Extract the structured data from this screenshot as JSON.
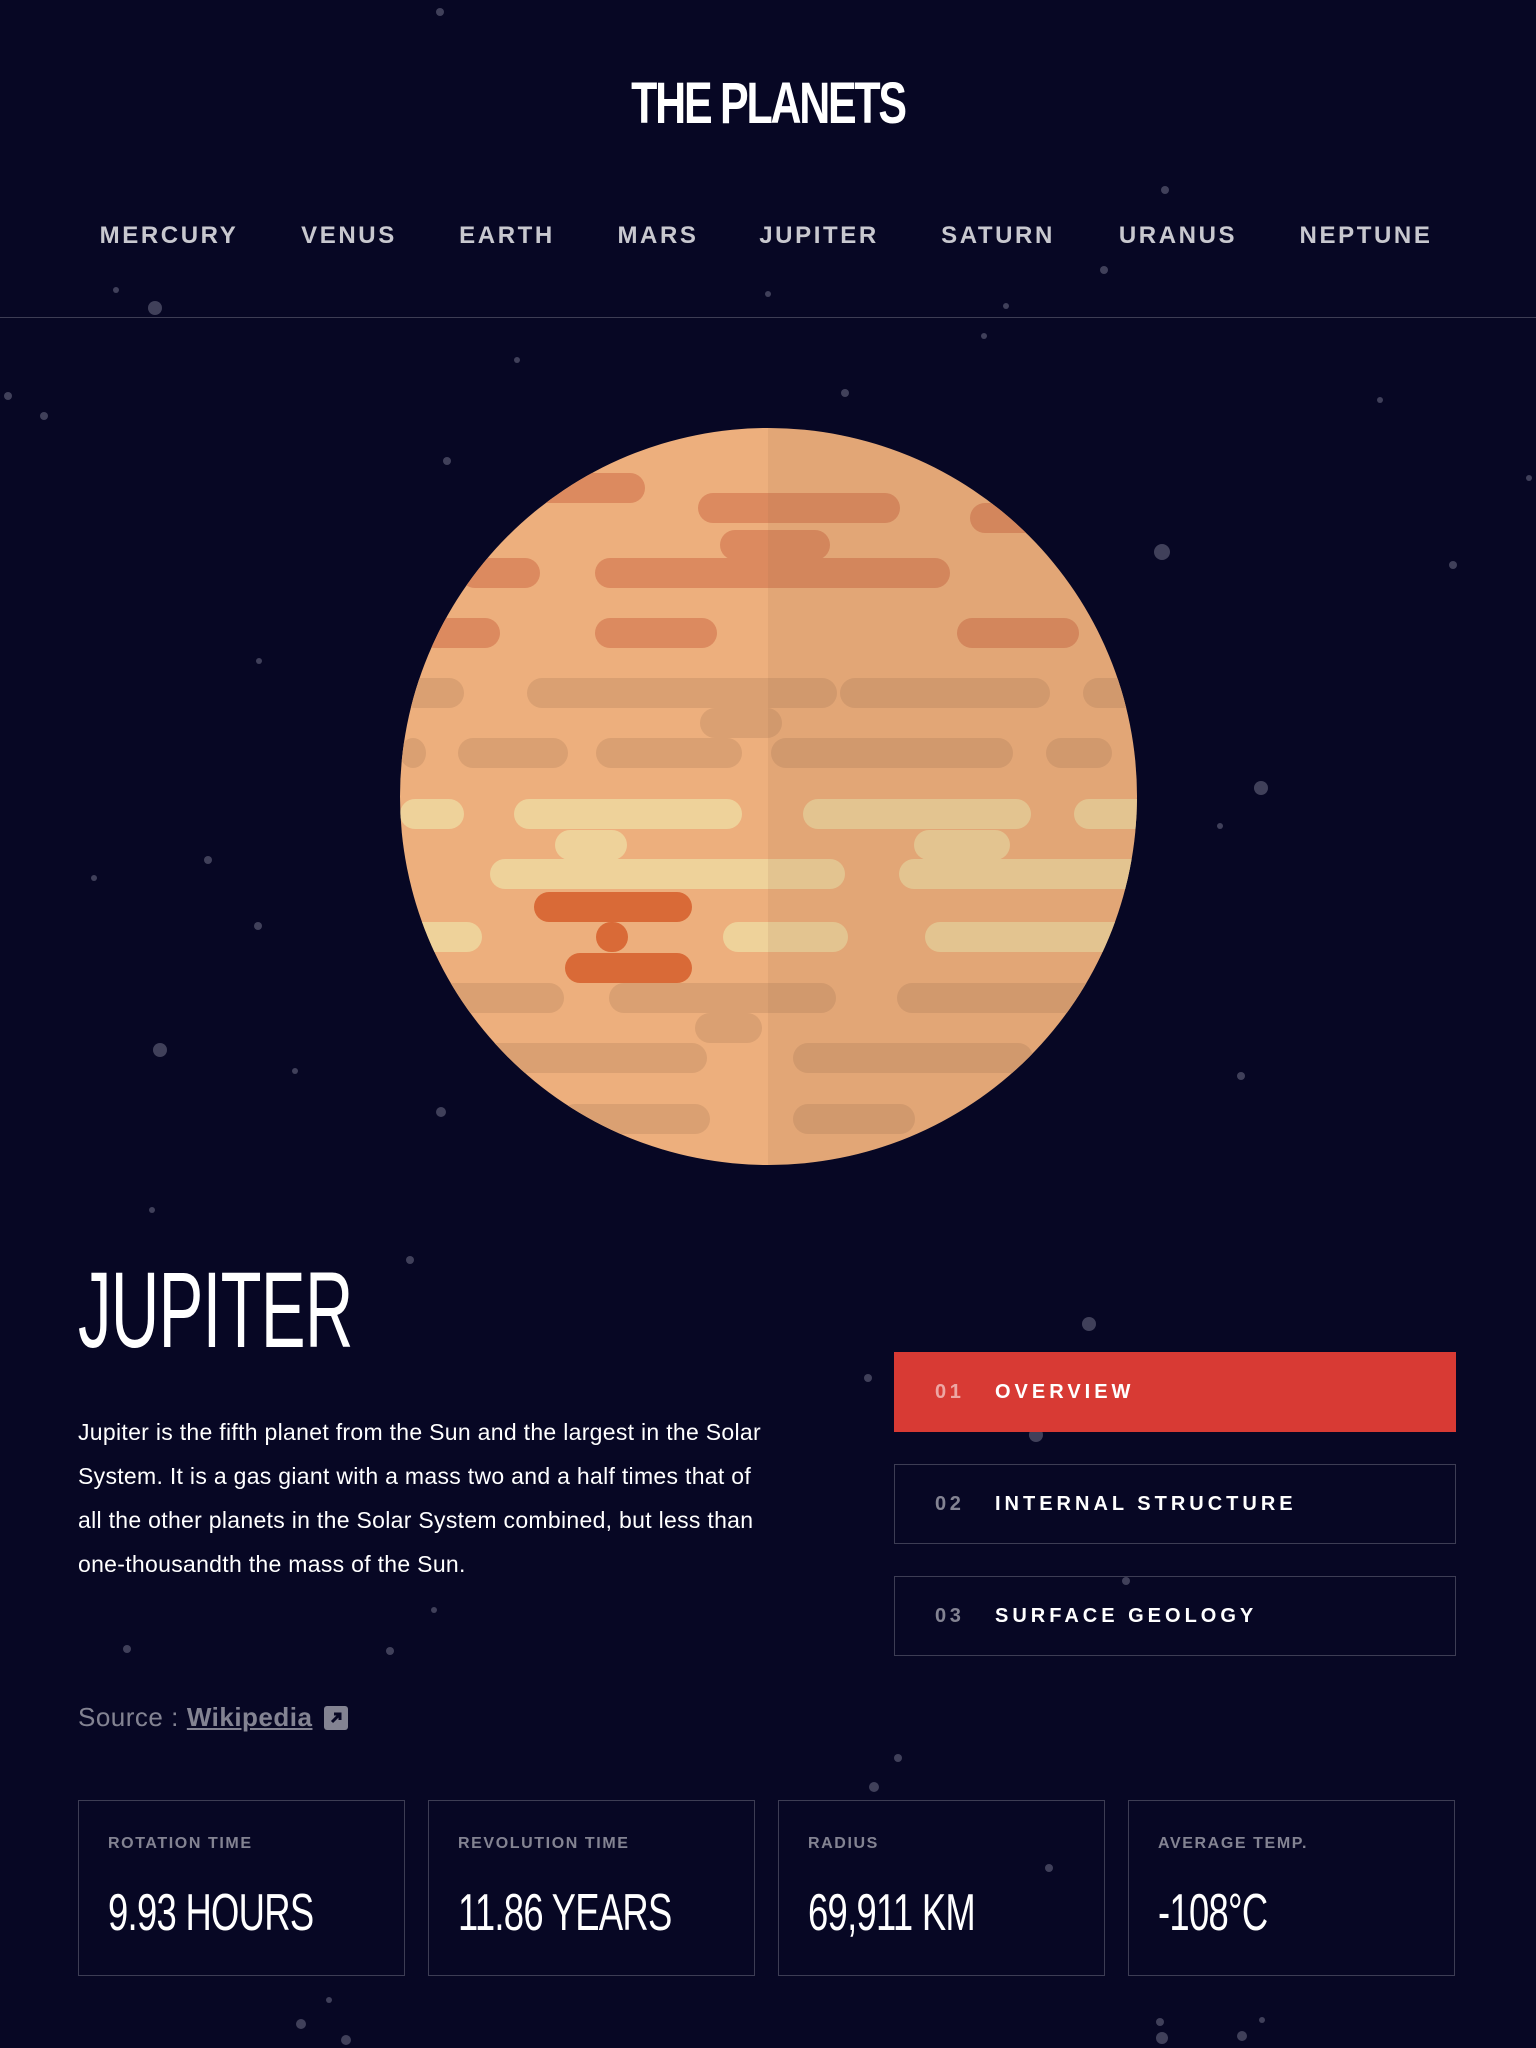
{
  "header": {
    "title": "THE PLANETS",
    "nav": [
      "MERCURY",
      "VENUS",
      "EARTH",
      "MARS",
      "JUPITER",
      "SATURN",
      "URANUS",
      "NEPTUNE"
    ],
    "active": "JUPITER"
  },
  "planet": {
    "name": "JUPITER",
    "description": "Jupiter is the fifth planet from the Sun and the largest in the Solar System. It is a gas giant with a mass two and a half times that of all the other planets in the Solar System combined, but less than one-thousandth the mass of the Sun.",
    "source_prefix": "Source :",
    "source_link": "Wikipedia",
    "source_icon": "external-link-icon"
  },
  "tabs": [
    {
      "num": "01",
      "label": "OVERVIEW",
      "active": true
    },
    {
      "num": "02",
      "label": "INTERNAL STRUCTURE",
      "active": false
    },
    {
      "num": "03",
      "label": "SURFACE GEOLOGY",
      "active": false
    }
  ],
  "stats": [
    {
      "label": "ROTATION TIME",
      "value": "9.93 HOURS"
    },
    {
      "label": "REVOLUTION TIME",
      "value": "11.86 YEARS"
    },
    {
      "label": "RADIUS",
      "value": "69,911 KM"
    },
    {
      "label": "AVERAGE TEMP.",
      "value": "-108°C"
    }
  ],
  "colors": {
    "background": "#070724",
    "accent": "#d83a34",
    "planet_base": "#edaf7d",
    "planet_shade": "#daa072",
    "band_dark": "#dc8a5f",
    "band_light": "#eed29a",
    "great_red_spot": "#d96a37"
  }
}
